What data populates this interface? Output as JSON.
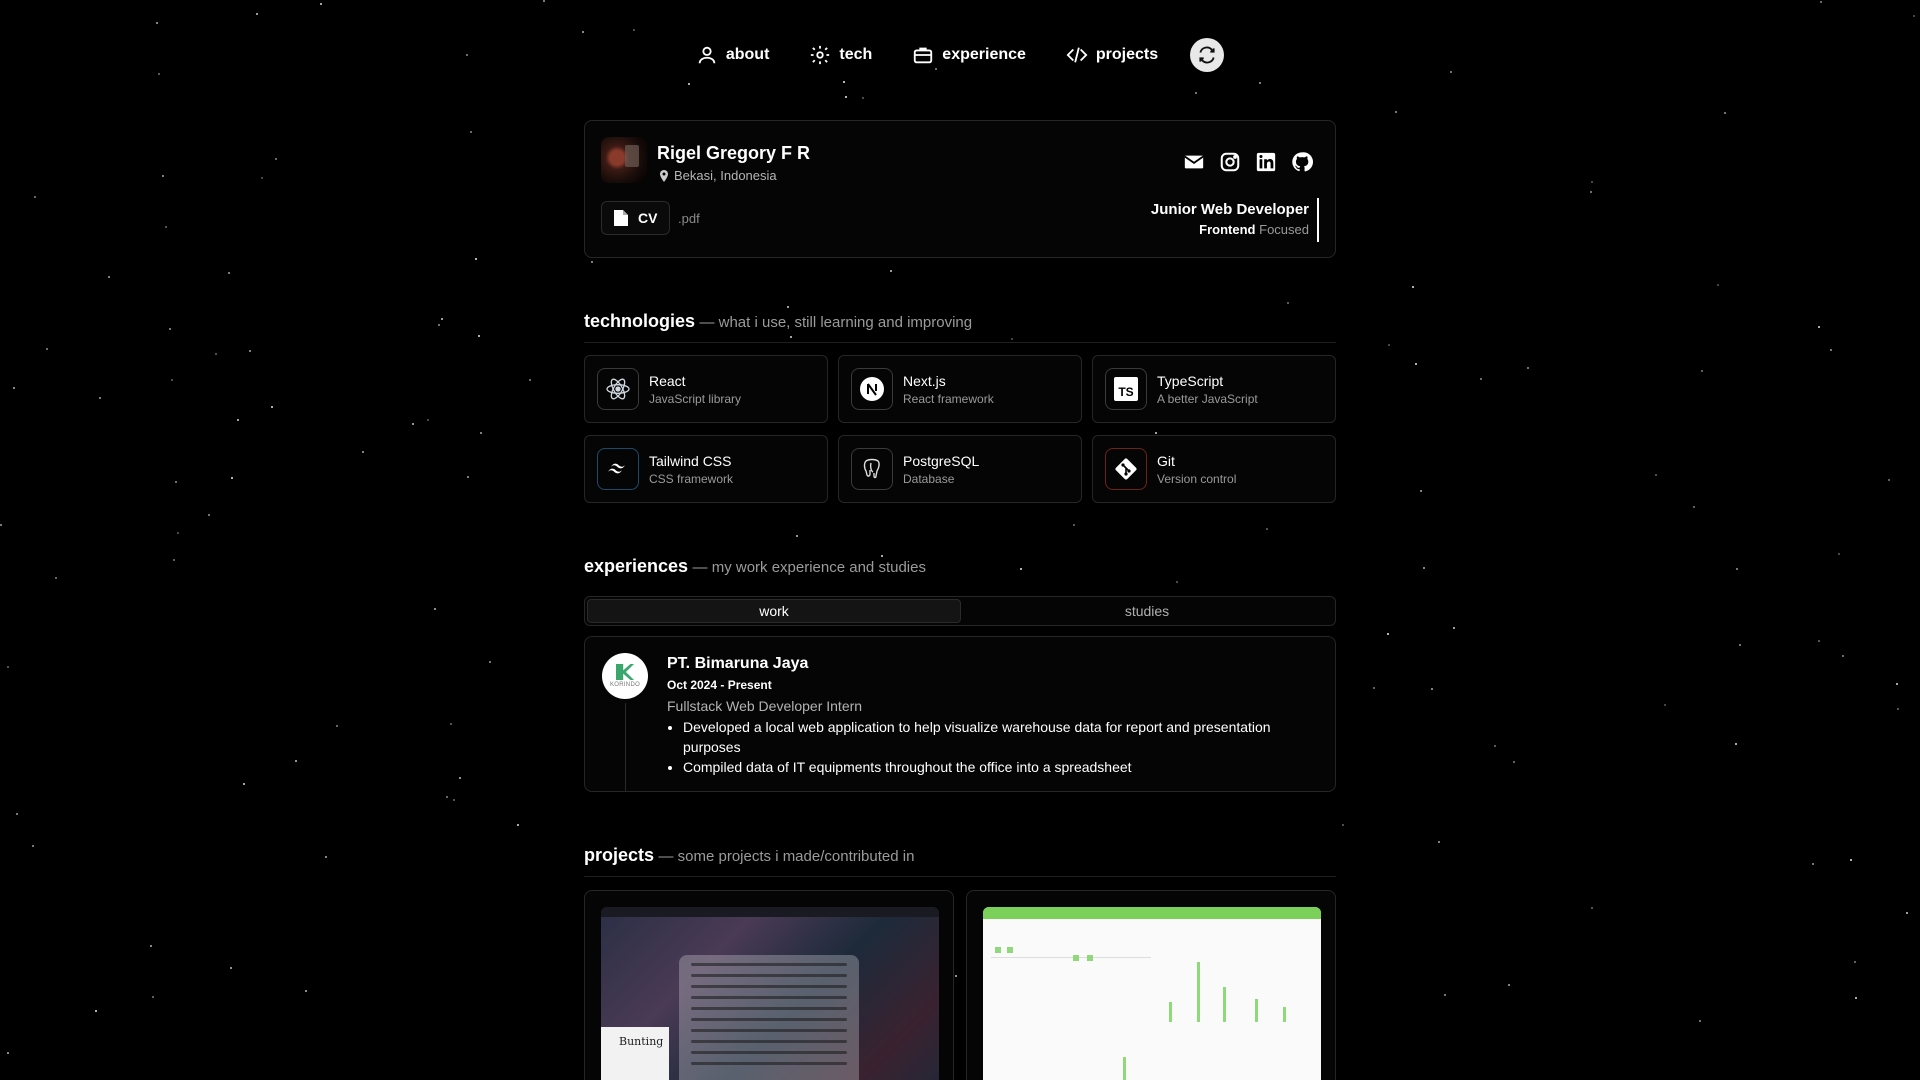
{
  "nav": {
    "items": [
      {
        "label": "about",
        "icon": "user-icon"
      },
      {
        "label": "tech",
        "icon": "gear-icon"
      },
      {
        "label": "experience",
        "icon": "briefcase-icon"
      },
      {
        "label": "projects",
        "icon": "code-icon"
      }
    ],
    "theme_icon": "refresh-icon"
  },
  "profile": {
    "name": "Rigel Gregory F R",
    "location": "Bekasi, Indonesia",
    "cv_label": "CV",
    "cv_ext": ".pdf",
    "role_title": "Junior Web Developer",
    "role_focus": "Frontend",
    "role_focus_suffix": "Focused",
    "socials": [
      "mail-icon",
      "instagram-icon",
      "linkedin-icon",
      "github-icon"
    ]
  },
  "technologies": {
    "title": "technologies",
    "subtitle": "— what i use, still learning and improving",
    "items": [
      {
        "name": "React",
        "desc": "JavaScript library",
        "icon": "react-icon",
        "color": "#61dafb"
      },
      {
        "name": "Next.js",
        "desc": "React framework",
        "icon": "nextjs-icon",
        "color": "#ffffff"
      },
      {
        "name": "TypeScript",
        "desc": "A better JavaScript",
        "icon": "typescript-icon",
        "color": "#ffffff"
      },
      {
        "name": "Tailwind CSS",
        "desc": "CSS framework",
        "icon": "tailwind-icon",
        "color": "#38bdf8"
      },
      {
        "name": "PostgreSQL",
        "desc": "Database",
        "icon": "postgresql-icon",
        "color": "#ffffff"
      },
      {
        "name": "Git",
        "desc": "Version control",
        "icon": "git-icon",
        "color": "#f05032"
      }
    ]
  },
  "experiences": {
    "title": "experiences",
    "subtitle": "— my work experience and studies",
    "tabs": [
      "work",
      "studies"
    ],
    "active_tab": "work",
    "entry": {
      "company": "PT. Bimaruna Jaya",
      "date": "Oct 2024 - Present",
      "role": "Fullstack Web Developer Intern",
      "logo_text": "KORINDO",
      "bullets": [
        "Developed a local web application to help visualize warehouse data for report and presentation purposes",
        "Compiled data of IT equipments throughout the office into a spreadsheet"
      ]
    }
  },
  "projects": {
    "title": "projects",
    "subtitle": "— some projects i made/contributed in",
    "thumb1_text": "Bunting"
  }
}
